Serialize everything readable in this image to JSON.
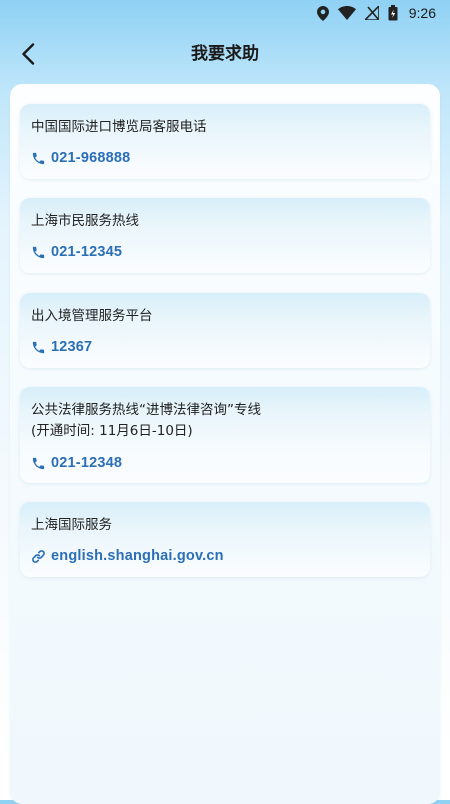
{
  "status_bar": {
    "time": "9:26",
    "icons": [
      "location-icon",
      "wifi-icon",
      "no-sim-icon",
      "battery-icon"
    ]
  },
  "header": {
    "title": "我要求助",
    "back_icon": "chevron-left-icon"
  },
  "contacts": [
    {
      "title": "中国国际进口博览局客服电话",
      "value": "021-968888",
      "icon": "phone-icon"
    },
    {
      "title": "上海市民服务热线",
      "value": "021-12345",
      "icon": "phone-icon"
    },
    {
      "title": "出入境管理服务平台",
      "value": "12367",
      "icon": "phone-icon"
    },
    {
      "title": "公共法律服务热线“进博法律咨询”专线",
      "subtitle": "(开通时间: 11月6日-10日)",
      "value": "021-12348",
      "icon": "phone-icon"
    },
    {
      "title": "上海国际服务",
      "value": "english.shanghai.gov.cn",
      "icon": "link-icon"
    }
  ],
  "colors": {
    "accent": "#2b6fb6",
    "title_text": "#1a1a1a",
    "card_header": "#d7eef9"
  }
}
